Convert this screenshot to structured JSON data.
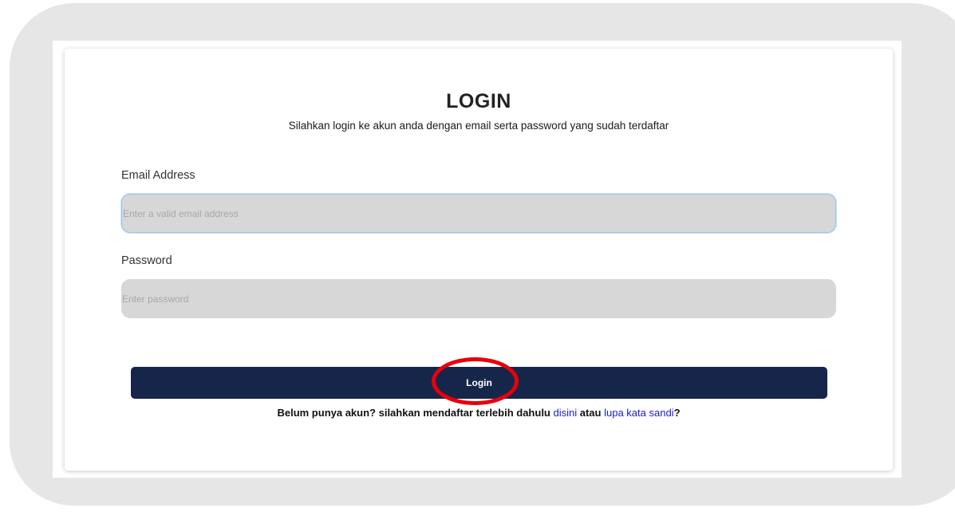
{
  "login": {
    "title": "LOGIN",
    "subtitle": "Silahkan login ke akun anda dengan email serta password yang sudah terdaftar",
    "email_label": "Email Address",
    "email_placeholder": "Enter a valid email address",
    "email_value": "",
    "password_label": "Password",
    "password_placeholder": "Enter password",
    "password_value": "",
    "button_label": "Login",
    "footer_prefix": "Belum punya akun? silahkan mendaftar terlebih dahulu",
    "footer_link_register": "disini",
    "footer_middle": "atau",
    "footer_link_forgot": "lupa kata sandi",
    "footer_suffix": "?"
  },
  "colors": {
    "frame_bg": "#e6e6e6",
    "input_bg": "#d7d7d7",
    "button_bg": "#16264a",
    "link": "#1a1acc",
    "annotation_circle": "#e8000b"
  }
}
